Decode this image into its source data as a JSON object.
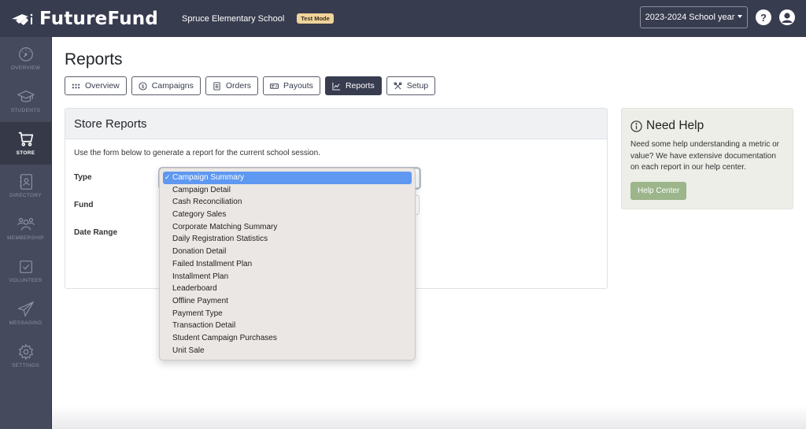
{
  "topbar": {
    "brand": "FutureFund",
    "school_name": "Spruce Elementary School",
    "test_mode_badge": "Test Mode",
    "school_year_select": "2023-2024 School year",
    "help_icon_glyph": "?"
  },
  "sidebar": {
    "items": [
      {
        "label": "Overview",
        "icon": "gauge-icon",
        "active": false
      },
      {
        "label": "Students",
        "icon": "graduation-cap-icon",
        "active": false
      },
      {
        "label": "Store",
        "icon": "shopping-cart-icon",
        "active": true
      },
      {
        "label": "Directory",
        "icon": "address-book-icon",
        "active": false
      },
      {
        "label": "Membership",
        "icon": "users-icon",
        "active": false
      },
      {
        "label": "Volunteer",
        "icon": "checkbox-icon",
        "active": false
      },
      {
        "label": "Messaging",
        "icon": "paper-plane-icon",
        "active": false
      },
      {
        "label": "Settings",
        "icon": "gear-icon",
        "active": false
      }
    ]
  },
  "main": {
    "title": "Reports",
    "tabs": [
      {
        "label": "Overview",
        "icon": "grid-icon",
        "active": false
      },
      {
        "label": "Campaigns",
        "icon": "dollar-circle-icon",
        "active": false
      },
      {
        "label": "Orders",
        "icon": "receipt-icon",
        "active": false
      },
      {
        "label": "Payouts",
        "icon": "check-payment-icon",
        "active": false
      },
      {
        "label": "Reports",
        "icon": "line-chart-icon",
        "active": true
      },
      {
        "label": "Setup",
        "icon": "tools-icon",
        "active": false
      }
    ]
  },
  "store_reports": {
    "title": "Store Reports",
    "description": "Use the form below to generate a report for the current school session.",
    "fields": {
      "type_label": "Type",
      "fund_label": "Fund",
      "date_range_label": "Date Range"
    },
    "type_dropdown": {
      "selected": "Campaign Summary",
      "check_glyph": "✓",
      "options": [
        "Campaign Summary",
        "Campaign Detail",
        "Cash Reconciliation",
        "Category Sales",
        "Corporate Matching Summary",
        "Daily Registration Statistics",
        "Donation Detail",
        "Failed Installment Plan",
        "Installment Plan",
        "Leaderboard",
        "Offline Payment",
        "Payment Type",
        "Transaction Detail",
        "Student Campaign Purchases",
        "Unit Sale"
      ]
    }
  },
  "help": {
    "title": "Need Help",
    "text": "Need some help understanding a metric or value? We have extensive documentation on each report in our help center.",
    "button": "Help Center"
  }
}
